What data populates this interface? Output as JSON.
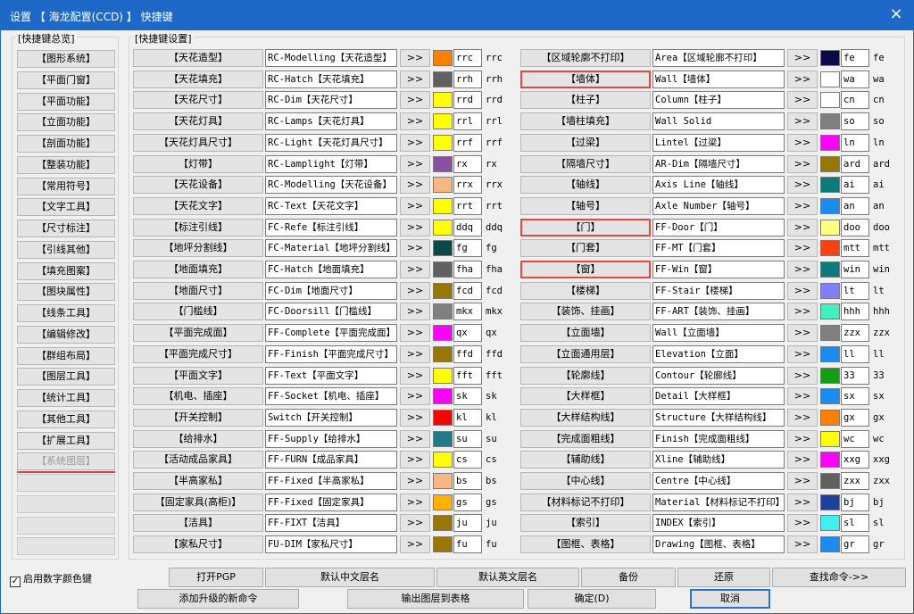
{
  "window": {
    "title": "设置 【 海龙配置(CCD) 】 快捷键",
    "close_icon": "×"
  },
  "overview": {
    "label": "[快捷键总览]",
    "items": [
      {
        "label": "【图形系统】",
        "disabled": false
      },
      {
        "label": "【平面门窗】",
        "disabled": false
      },
      {
        "label": "【平面功能】",
        "disabled": false
      },
      {
        "label": "【立面功能】",
        "disabled": false
      },
      {
        "label": "【剖面功能】",
        "disabled": false
      },
      {
        "label": "【整装功能】",
        "disabled": false
      },
      {
        "label": "【常用符号】",
        "disabled": false
      },
      {
        "label": "【文字工具】",
        "disabled": false
      },
      {
        "label": "【尺寸标注】",
        "disabled": false
      },
      {
        "label": "【引线其他】",
        "disabled": false
      },
      {
        "label": "【填充图案】",
        "disabled": false
      },
      {
        "label": "【图块属性】",
        "disabled": false
      },
      {
        "label": "【线条工具】",
        "disabled": false
      },
      {
        "label": "【编辑修改】",
        "disabled": false
      },
      {
        "label": "【群组布局】",
        "disabled": false
      },
      {
        "label": "【图层工具】",
        "disabled": false
      },
      {
        "label": "【统计工具】",
        "disabled": false
      },
      {
        "label": "【其他工具】",
        "disabled": false
      },
      {
        "label": "【扩展工具】",
        "disabled": false
      },
      {
        "label": "【系统图层】",
        "disabled": true
      }
    ],
    "blank_count": 4
  },
  "settings": {
    "label": "[快捷键设置]",
    "go_label": ">>",
    "left": [
      {
        "name": "【天花造型】",
        "cmd": "RC-Modelling【天花造型】",
        "color": "#ff8000",
        "alias": "rrc",
        "alias2": "rrc"
      },
      {
        "name": "【天花填充】",
        "cmd": "RC-Hatch【天花填充】",
        "color": "#606060",
        "alias": "rrh",
        "alias2": "rrh"
      },
      {
        "name": "【天花尺寸】",
        "cmd": "RC-Dim【天花尺寸】",
        "color": "#ffff00",
        "alias": "rrd",
        "alias2": "rrd"
      },
      {
        "name": "【天花灯具】",
        "cmd": "RC-Lamps【天花灯具】",
        "color": "#ffff00",
        "alias": "rrl",
        "alias2": "rrl"
      },
      {
        "name": "【天花灯具尺寸】",
        "cmd": "RC-Light【天花灯具尺寸】",
        "color": "#ffff00",
        "alias": "rrf",
        "alias2": "rrf"
      },
      {
        "name": "【灯带】",
        "cmd": "RC-Lamplight【灯带】",
        "color": "#8b4fa0",
        "alias": "rx",
        "alias2": "rx"
      },
      {
        "name": "【天花设备】",
        "cmd": "RC-Modelling【天花设备】",
        "color": "#f7b784",
        "alias": "rrx",
        "alias2": "rrx"
      },
      {
        "name": "【天花文字】",
        "cmd": "RC-Text【天花文字】",
        "color": "#ffff00",
        "alias": "rrt",
        "alias2": "rrt"
      },
      {
        "name": "【标注引线】",
        "cmd": "FC-Refe【标注引线】",
        "color": "#ffff00",
        "alias": "ddq",
        "alias2": "ddq"
      },
      {
        "name": "【地坪分割线】",
        "cmd": "FC-Material【地坪分割线】",
        "color": "#0b4848",
        "alias": "fg",
        "alias2": "fg"
      },
      {
        "name": "【地面填充】",
        "cmd": "FC-Hatch【地面填充】",
        "color": "#606060",
        "alias": "fha",
        "alias2": "fha"
      },
      {
        "name": "【地面尺寸】",
        "cmd": "FC-Dim【地面尺寸】",
        "color": "#9a7606",
        "alias": "fcd",
        "alias2": "fcd"
      },
      {
        "name": "【门槛线】",
        "cmd": "FC-Doorsill【门槛线】",
        "color": "#808080",
        "alias": "mkx",
        "alias2": "mkx"
      },
      {
        "name": "【平面完成面】",
        "cmd": "FF-Complete【平面完成面】",
        "color": "#ff00ff",
        "alias": "qx",
        "alias2": "qx"
      },
      {
        "name": "【平面完成尺寸】",
        "cmd": "FF-Finish【平面完成尺寸】",
        "color": "#9a7606",
        "alias": "ffd",
        "alias2": "ffd"
      },
      {
        "name": "【平面文字】",
        "cmd": "FF-Text【平面文字】",
        "color": "#ffff00",
        "alias": "fft",
        "alias2": "fft"
      },
      {
        "name": "【机电、插座】",
        "cmd": "FF-Socket【机电、插座】",
        "color": "#ff00ff",
        "alias": "sk",
        "alias2": "sk"
      },
      {
        "name": "【开关控制】",
        "cmd": "Switch【开关控制】",
        "color": "#ff0000",
        "alias": "kl",
        "alias2": "kl"
      },
      {
        "name": "【给排水】",
        "cmd": "FF-Supply【给排水】",
        "color": "#1f7a8c",
        "alias": "su",
        "alias2": "su"
      },
      {
        "name": "【活动成品家具】",
        "cmd": "FF-FURN【成品家具】",
        "color": "#ffff00",
        "alias": "cs",
        "alias2": "cs"
      },
      {
        "name": "【半高家私】",
        "cmd": "FF-Fixed【半高家私】",
        "color": "#f7b784",
        "alias": "bs",
        "alias2": "bs"
      },
      {
        "name": "【固定家具(高柜)】",
        "cmd": "FF-Fixed【固定家具】",
        "color": "#ffb000",
        "alias": "gs",
        "alias2": "gs"
      },
      {
        "name": "【洁具】",
        "cmd": "FF-FIXT【洁具】",
        "color": "#9a7606",
        "alias": "ju",
        "alias2": "ju"
      },
      {
        "name": "【家私尺寸】",
        "cmd": "FU-DIM【家私尺寸】",
        "color": "#9a7606",
        "alias": "fu",
        "alias2": "fu"
      }
    ],
    "right": [
      {
        "name": "【区域轮廓不打印】",
        "cmd": "Area【区域轮廓不打印】",
        "color": "#0a0a4a",
        "alias": "fe",
        "alias2": "fe",
        "hl": false
      },
      {
        "name": "【墙体】",
        "cmd": "Wall【墙体】",
        "color": "#ffffff",
        "alias": "wa",
        "alias2": "wa",
        "hl": true
      },
      {
        "name": "【柱子】",
        "cmd": "Column【柱子】",
        "color": "#ffffff",
        "alias": "cn",
        "alias2": "cn",
        "hl": false
      },
      {
        "name": "【墙柱填充】",
        "cmd": "Wall Solid",
        "color": "#808080",
        "alias": "so",
        "alias2": "so",
        "hl": false
      },
      {
        "name": "【过梁】",
        "cmd": "Lintel【过梁】",
        "color": "#ff00ff",
        "alias": "ln",
        "alias2": "ln",
        "hl": false
      },
      {
        "name": "【隔墙尺寸】",
        "cmd": "AR-Dim【隔墙尺寸】",
        "color": "#9a7606",
        "alias": "ard",
        "alias2": "ard",
        "hl": false
      },
      {
        "name": "【轴线】",
        "cmd": "Axis Line【轴线】",
        "color": "#0a7a7a",
        "alias": "ai",
        "alias2": "ai",
        "hl": false
      },
      {
        "name": "【轴号】",
        "cmd": "Axle Number【轴号】",
        "color": "#1a8cf0",
        "alias": "an",
        "alias2": "an",
        "hl": false
      },
      {
        "name": "【门】",
        "cmd": "FF-Door【门】",
        "color": "#ffff80",
        "alias": "doo",
        "alias2": "doo",
        "hl": true
      },
      {
        "name": "【门套】",
        "cmd": "FF-MT【门套】",
        "color": "#ff4010",
        "alias": "mtt",
        "alias2": "mtt",
        "hl": false
      },
      {
        "name": "【窗】",
        "cmd": "FF-Win【窗】",
        "color": "#0a7a7a",
        "alias": "win",
        "alias2": "win",
        "hl": true
      },
      {
        "name": "【楼梯】",
        "cmd": "FF-Stair【楼梯】",
        "color": "#8080ff",
        "alias": "lt",
        "alias2": "lt",
        "hl": false
      },
      {
        "name": "【装饰、挂画】",
        "cmd": "FF-ART【装饰、挂画】",
        "color": "#40f0c0",
        "alias": "hhh",
        "alias2": "hhh",
        "hl": false
      },
      {
        "name": "【立面墙】",
        "cmd": "Wall【立面墙】",
        "color": "#808080",
        "alias": "zzx",
        "alias2": "zzx",
        "hl": false
      },
      {
        "name": "【立面通用层】",
        "cmd": "Elevation【立面】",
        "color": "#1a8cf0",
        "alias": "ll",
        "alias2": "ll",
        "hl": false
      },
      {
        "name": "【轮廓线】",
        "cmd": "Contour【轮廓线】",
        "color": "#10a010",
        "alias": "33",
        "alias2": "33",
        "hl": false
      },
      {
        "name": "【大样框】",
        "cmd": "Detail【大样框】",
        "color": "#1a8cf0",
        "alias": "sx",
        "alias2": "sx",
        "hl": false
      },
      {
        "name": "【大样结构线】",
        "cmd": "Structure【大样结构线】",
        "color": "#ff8000",
        "alias": "gx",
        "alias2": "gx",
        "hl": false
      },
      {
        "name": "【完成面粗线】",
        "cmd": "Finish【完成面粗线】",
        "color": "#ffff00",
        "alias": "wc",
        "alias2": "wc",
        "hl": false
      },
      {
        "name": "【辅助线】",
        "cmd": "Xline【辅助线】",
        "color": "#ff00ff",
        "alias": "xxg",
        "alias2": "xxg",
        "hl": false
      },
      {
        "name": "【中心线】",
        "cmd": "Centre【中心线】",
        "color": "#606060",
        "alias": "zxx",
        "alias2": "zxx",
        "hl": false
      },
      {
        "name": "【材料标记不打印】",
        "cmd": "Material【材料标记不打印】",
        "color": "#2040a0",
        "alias": "bj",
        "alias2": "bj",
        "hl": false
      },
      {
        "name": "【索引】",
        "cmd": "INDEX【索引】",
        "color": "#40f0f0",
        "alias": "sl",
        "alias2": "sl",
        "hl": false
      },
      {
        "name": "【图框、表格】",
        "cmd": "Drawing【图框、表格】",
        "color": "#1a8cf0",
        "alias": "gr",
        "alias2": "gr",
        "hl": false
      }
    ]
  },
  "bottom": {
    "checkbox_label": "启用数字颜色键",
    "checkbox_checked": true,
    "checkbox_mark": "✓",
    "buttons_row1": [
      "打开PGP",
      "默认中文层名",
      "默认英文层名",
      "备份",
      "还原",
      "查找命令->>"
    ],
    "buttons_row2": [
      "添加升级的新命令",
      "输出图层到表格",
      "确定(D)",
      "取消"
    ]
  }
}
